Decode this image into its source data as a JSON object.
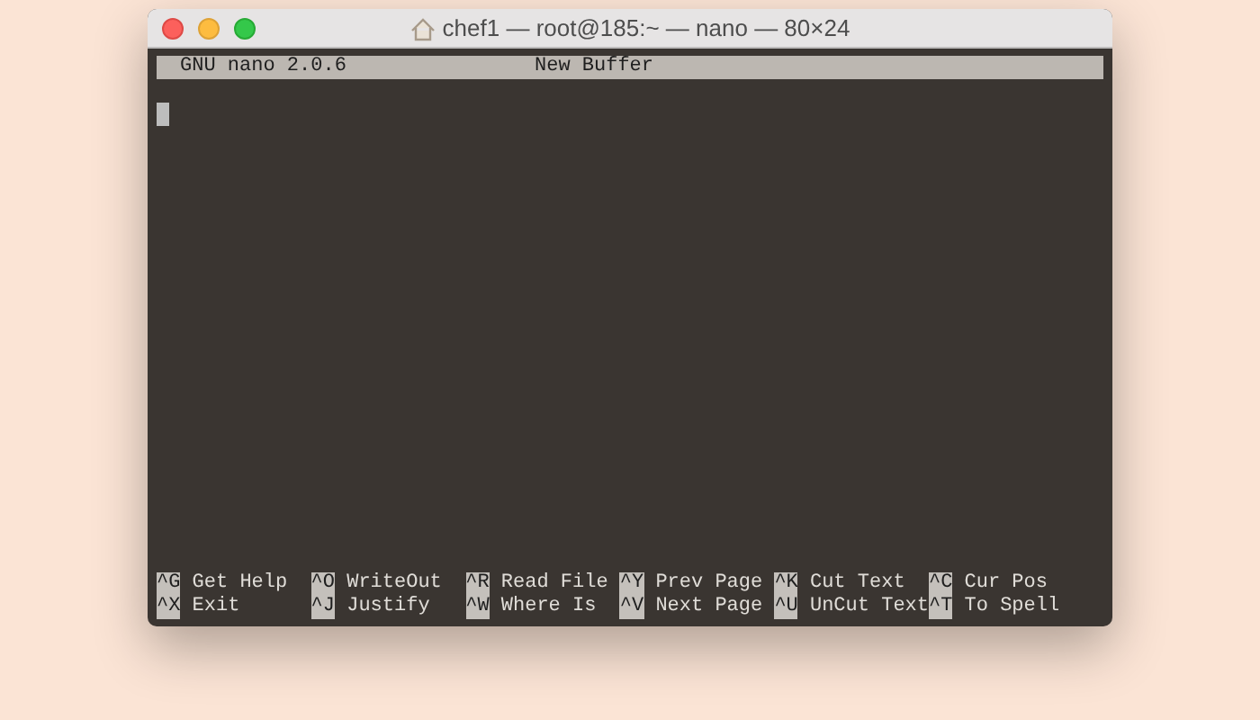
{
  "window": {
    "title": "chef1 — root@185:~ — nano — 80×24"
  },
  "header": {
    "version": "GNU nano 2.0.6",
    "buffer": "New Buffer"
  },
  "shortcuts": [
    {
      "key": "^G",
      "label": "Get Help"
    },
    {
      "key": "^O",
      "label": "WriteOut"
    },
    {
      "key": "^R",
      "label": "Read File"
    },
    {
      "key": "^Y",
      "label": "Prev Page"
    },
    {
      "key": "^K",
      "label": "Cut Text"
    },
    {
      "key": "^C",
      "label": "Cur Pos"
    },
    {
      "key": "^X",
      "label": "Exit"
    },
    {
      "key": "^J",
      "label": "Justify"
    },
    {
      "key": "^W",
      "label": "Where Is"
    },
    {
      "key": "^V",
      "label": "Next Page"
    },
    {
      "key": "^U",
      "label": "UnCut Text"
    },
    {
      "key": "^T",
      "label": "To Spell"
    }
  ]
}
